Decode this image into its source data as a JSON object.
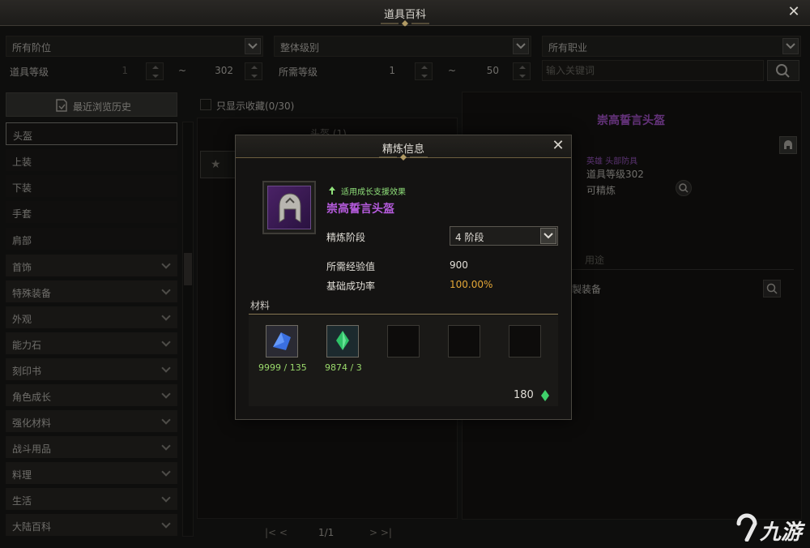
{
  "window": {
    "title": "道具百科"
  },
  "filters": {
    "tier_select": "所有阶位",
    "grade_select": "整体级别",
    "class_select": "所有职业",
    "item_level_label": "道具等级",
    "item_level_min": "1",
    "item_level_max": "302",
    "range_sep": "~",
    "required_level_label": "所需等级",
    "required_level_min": "1",
    "required_level_max": "50",
    "search_placeholder": "输入关键词"
  },
  "sidebar": {
    "history_label": "最近浏览历史",
    "sub_items": [
      {
        "label": "头盔",
        "selected": true
      },
      {
        "label": "上装"
      },
      {
        "label": "下装"
      },
      {
        "label": "手套"
      },
      {
        "label": "肩部"
      }
    ],
    "categories": [
      {
        "label": "首饰"
      },
      {
        "label": "特殊装备"
      },
      {
        "label": "外观"
      },
      {
        "label": "能力石"
      },
      {
        "label": "刻印书"
      },
      {
        "label": "角色成长"
      },
      {
        "label": "强化材料"
      },
      {
        "label": "战斗用品"
      },
      {
        "label": "料理"
      },
      {
        "label": "生活"
      },
      {
        "label": "大陆百科"
      }
    ]
  },
  "list": {
    "favorites_only_label": "只显示收藏(0/30)",
    "group_header": "头盔 (1)",
    "pager": "1/1"
  },
  "detail": {
    "item_name": "崇高誓言头盔",
    "category": "英雄 头部防具",
    "item_level": "道具等级302",
    "refinable": "可精炼",
    "tab_usage": "用途",
    "usage_entry": "製装备"
  },
  "modal": {
    "title": "精炼信息",
    "growth_support": "适用成长支援效果",
    "item_name": "崇高誓言头盔",
    "tier_label": "精炼阶段",
    "tier_value": "4 阶段",
    "exp_label": "所需经验值",
    "exp_value": "900",
    "success_label": "基础成功率",
    "success_value": "100.00%",
    "materials_label": "材料",
    "materials": [
      {
        "icon": "blue-crystal-icon",
        "count": "9999 / 135"
      },
      {
        "icon": "green-shard-icon",
        "count": "9874 / 3"
      }
    ],
    "cost": "180",
    "colors": {
      "epic_name": "#b55bdc",
      "success_gold": "#e4a737",
      "material_count": "#9ad96b"
    }
  },
  "watermark": "九游"
}
